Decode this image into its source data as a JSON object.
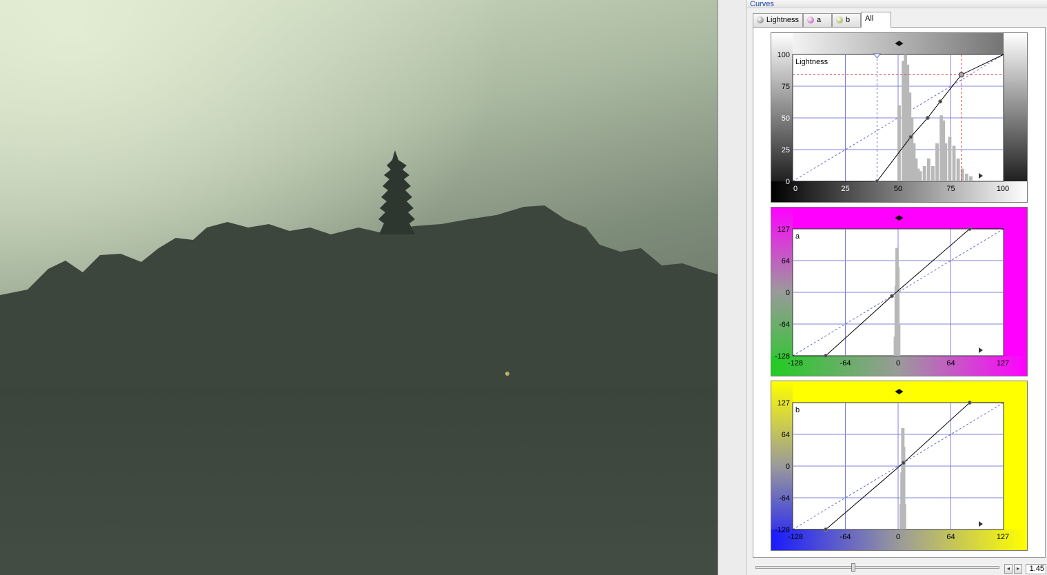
{
  "panel": {
    "title": "Curves"
  },
  "tabs": [
    {
      "label": "Lightness",
      "ball_color": "#6a6a6a"
    },
    {
      "label": "a",
      "ball_color": "#b03aa8"
    },
    {
      "label": "b",
      "ball_color": "#8aa020"
    },
    {
      "label": "All",
      "active": true
    }
  ],
  "curves": {
    "lightness": {
      "label": "Lightness",
      "x_ticks": [
        "0",
        "25",
        "50",
        "75",
        "100"
      ],
      "y_ticks": [
        "100",
        "75",
        "50",
        "25",
        "0"
      ],
      "range": [
        0,
        100
      ],
      "points": [
        [
          0,
          0
        ],
        [
          40,
          0
        ],
        [
          56,
          35
        ],
        [
          64,
          50
        ],
        [
          70,
          63
        ],
        [
          80,
          84
        ],
        [
          100,
          100
        ]
      ],
      "selected_point": [
        80,
        84
      ],
      "crosshair_x": 40
    },
    "a": {
      "label": "a",
      "x_ticks": [
        "-128",
        "-64",
        "0",
        "64",
        "127"
      ],
      "y_ticks": [
        "127",
        "64",
        "0",
        "-64",
        "-128"
      ],
      "range": [
        -128,
        127
      ],
      "points": [
        [
          -128,
          -128
        ],
        [
          -88,
          -128
        ],
        [
          -8,
          -8
        ],
        [
          86,
          127
        ],
        [
          127,
          127
        ]
      ],
      "gradient_start": "#22cc22",
      "gradient_end": "#ff00ff"
    },
    "b": {
      "label": "b",
      "x_ticks": [
        "-128",
        "-64",
        "0",
        "64",
        "127"
      ],
      "y_ticks": [
        "127",
        "64",
        "0",
        "-64",
        "-128"
      ],
      "range": [
        -128,
        127
      ],
      "points": [
        [
          -128,
          -128
        ],
        [
          -88,
          -128
        ],
        [
          6,
          6
        ],
        [
          86,
          127
        ],
        [
          127,
          127
        ]
      ],
      "gradient_start": "#1a1aff",
      "gradient_end": "#ffff00"
    }
  },
  "zoom": {
    "value": "1.45"
  },
  "colors": {
    "grid": "#8080d8",
    "dash_red": "#e04040",
    "dash_blue": "#6a6ac8"
  }
}
